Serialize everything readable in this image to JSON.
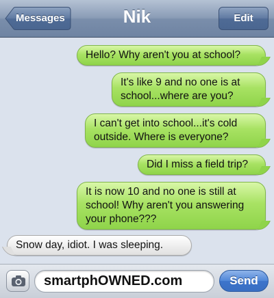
{
  "navbar": {
    "back_label": "Messages",
    "title": "Nik",
    "edit_label": "Edit"
  },
  "messages": [
    {
      "direction": "sent",
      "text": "Hello? Why aren't you at school?"
    },
    {
      "direction": "sent",
      "text": "It's like 9 and no one is at school...where are you?"
    },
    {
      "direction": "sent",
      "text": "I can't get into school...it's cold outside. Where is everyone?"
    },
    {
      "direction": "sent",
      "text": "Did I miss a field trip?"
    },
    {
      "direction": "sent",
      "text": "It is now 10 and no one is still at school! Why aren't you answering your phone???"
    },
    {
      "direction": "received",
      "text": "Snow day, idiot. I was sleeping."
    }
  ],
  "composer": {
    "text_value": "smartphOWNED.com",
    "send_label": "Send",
    "camera_icon": "camera-icon"
  },
  "colors": {
    "sent_bubble": "#a8e263",
    "received_bubble": "#ececec",
    "send_button": "#4f86d8",
    "navbar": "#8a9cb6"
  }
}
